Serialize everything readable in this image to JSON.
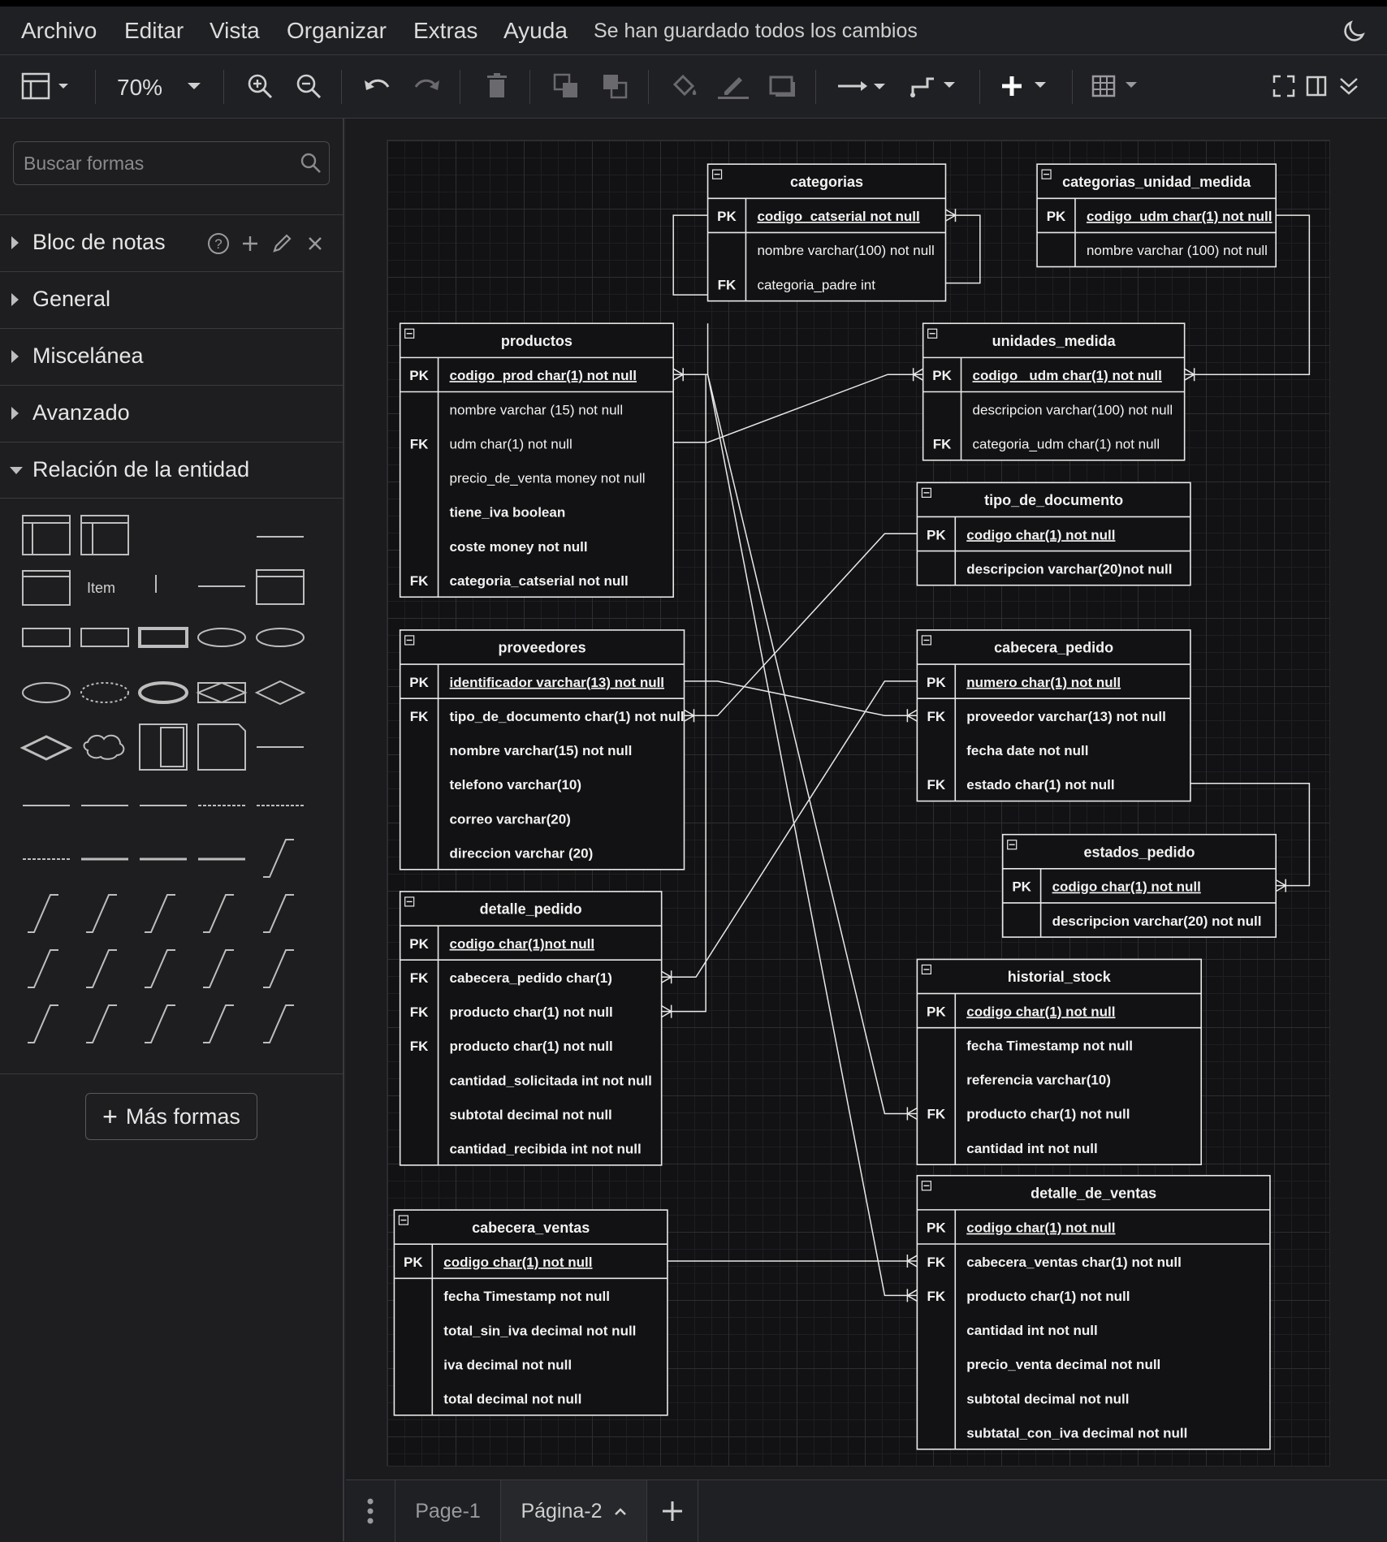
{
  "menu": {
    "items": [
      "Archivo",
      "Editar",
      "Vista",
      "Organizar",
      "Extras",
      "Ayuda"
    ],
    "status": "Se han guardado todos los cambios"
  },
  "toolbar": {
    "zoom": "70%"
  },
  "sidebar": {
    "search_placeholder": "Buscar formas",
    "sections": [
      "Bloc de notas",
      "General",
      "Miscelánea",
      "Avanzado",
      "Relación de la entidad"
    ],
    "shape_item_label": "Item",
    "more_shapes": "Más formas"
  },
  "pages": {
    "tabs": [
      "Page-1",
      "Página-2"
    ]
  },
  "colors": {
    "canvas": "#121214",
    "stroke": "#e8e8e8",
    "ui_bg": "#1f2023"
  },
  "entities": [
    {
      "name": "categorias",
      "rows": [
        {
          "key": "PK",
          "text": "codigo_catserial not null",
          "pk": true
        },
        {
          "key": "",
          "text": "nombre varchar(100) not null"
        },
        {
          "key": "FK",
          "text": "categoria_padre int"
        }
      ]
    },
    {
      "name": "categorias_unidad_medida",
      "rows": [
        {
          "key": "PK",
          "text": "codigo_udm char(1) not null",
          "pk": true
        },
        {
          "key": "",
          "text": "nombre varchar (100) not null"
        }
      ]
    },
    {
      "name": "productos",
      "rows": [
        {
          "key": "PK",
          "text": "codigo_prod char(1) not null",
          "pk": true
        },
        {
          "key": "",
          "text": "nombre varchar (15) not null"
        },
        {
          "key": "FK",
          "text": "udm char(1) not null"
        },
        {
          "key": "",
          "text": "precio_de_venta money not null"
        },
        {
          "key": "",
          "text": "tiene_iva boolean",
          "bold": true
        },
        {
          "key": "",
          "text": "coste money not null",
          "bold": true
        },
        {
          "key": "FK",
          "text": "categoria_catserial not null",
          "bold": true
        }
      ]
    },
    {
      "name": "unidades_medida",
      "rows": [
        {
          "key": "PK",
          "text": "codigo_ udm char(1) not null",
          "pk": true
        },
        {
          "key": "",
          "text": "descripcion varchar(100) not null"
        },
        {
          "key": "FK",
          "text": "categoria_udm char(1) not null"
        }
      ]
    },
    {
      "name": "tipo_de_documento",
      "rows": [
        {
          "key": "PK",
          "text": "codigo char(1) not null",
          "pk": true
        },
        {
          "key": "",
          "text": "descripcion varchar(20)not null",
          "bold": true
        }
      ]
    },
    {
      "name": "proveedores",
      "rows": [
        {
          "key": "PK",
          "text": "identificador varchar(13) not null",
          "pk": true
        },
        {
          "key": "FK",
          "text": "tipo_de_documento char(1) not null",
          "bold": true
        },
        {
          "key": "",
          "text": "nombre varchar(15) not null",
          "bold": true
        },
        {
          "key": "",
          "text": "telefono varchar(10)",
          "bold": true
        },
        {
          "key": "",
          "text": "correo varchar(20)",
          "bold": true
        },
        {
          "key": "",
          "text": "direccion varchar (20)",
          "bold": true
        }
      ]
    },
    {
      "name": "cabecera_pedido",
      "rows": [
        {
          "key": "PK",
          "text": "numero char(1) not null",
          "pk": true
        },
        {
          "key": "FK",
          "text": "proveedor varchar(13) not null",
          "bold": true
        },
        {
          "key": "",
          "text": "fecha date not null",
          "bold": true
        },
        {
          "key": "FK",
          "text": "estado char(1) not null",
          "bold": true
        }
      ]
    },
    {
      "name": "estados_pedido",
      "rows": [
        {
          "key": "PK",
          "text": "codigo char(1) not null",
          "pk": true
        },
        {
          "key": "",
          "text": "descripcion varchar(20) not null",
          "bold": true
        }
      ]
    },
    {
      "name": "detalle_pedido",
      "rows": [
        {
          "key": "PK",
          "text": "codigo char(1)not null",
          "pk": true
        },
        {
          "key": "FK",
          "text": "cabecera_pedido char(1)",
          "bold": true
        },
        {
          "key": "FK",
          "text": "producto char(1) not null",
          "bold": true
        },
        {
          "key": "FK",
          "text": "producto char(1) not null",
          "bold": true
        },
        {
          "key": "",
          "text": "cantidad_solicitada int not null",
          "bold": true
        },
        {
          "key": "",
          "text": "subtotal decimal not null",
          "bold": true
        },
        {
          "key": "",
          "text": "cantidad_recibida int not null",
          "bold": true
        }
      ]
    },
    {
      "name": "historial_stock",
      "rows": [
        {
          "key": "PK",
          "text": "codigo char(1) not null",
          "pk": true
        },
        {
          "key": "",
          "text": "fecha Timestamp not null",
          "bold": true
        },
        {
          "key": "",
          "text": "referencia varchar(10)",
          "bold": true
        },
        {
          "key": "FK",
          "text": "producto char(1) not null",
          "bold": true
        },
        {
          "key": "",
          "text": "cantidad int not null",
          "bold": true
        }
      ]
    },
    {
      "name": "cabecera_ventas",
      "rows": [
        {
          "key": "PK",
          "text": "codigo char(1) not null",
          "pk": true
        },
        {
          "key": "",
          "text": "fecha Timestamp not null",
          "bold": true
        },
        {
          "key": "",
          "text": "total_sin_iva decimal not null",
          "bold": true
        },
        {
          "key": "",
          "text": "iva decimal not null",
          "bold": true
        },
        {
          "key": "",
          "text": "total decimal not null",
          "bold": true
        }
      ]
    },
    {
      "name": "detalle_de_ventas",
      "rows": [
        {
          "key": "PK",
          "text": "codigo char(1) not null",
          "pk": true
        },
        {
          "key": "FK",
          "text": "cabecera_ventas char(1) not null",
          "bold": true
        },
        {
          "key": "FK",
          "text": "producto char(1) not null",
          "bold": true
        },
        {
          "key": "",
          "text": "cantidad int not null",
          "bold": true
        },
        {
          "key": "",
          "text": "precio_venta decimal not null",
          "bold": true
        },
        {
          "key": "",
          "text": "subtotal decimal not null",
          "bold": true
        },
        {
          "key": "",
          "text": "subtatal_con_iva decimal not null",
          "bold": true
        }
      ]
    }
  ]
}
